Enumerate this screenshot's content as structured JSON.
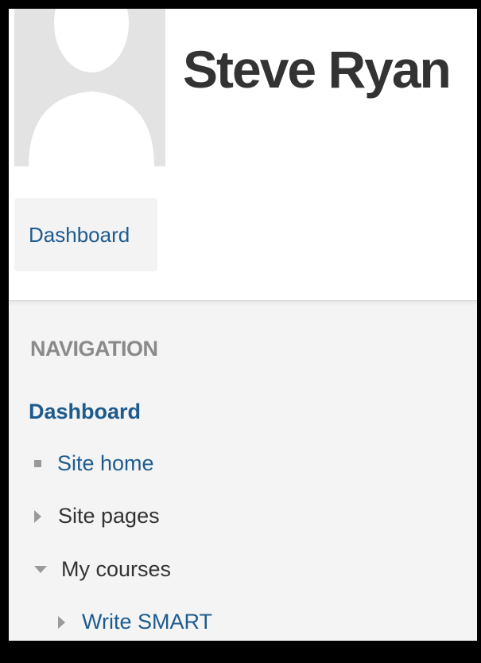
{
  "profile": {
    "name": "Steve Ryan",
    "avatar_icon": "default-user-avatar"
  },
  "header": {
    "dashboard_button_label": "Dashboard"
  },
  "navigation": {
    "heading": "NAVIGATION",
    "items": [
      {
        "label": "Dashboard",
        "icon": "",
        "link": true,
        "bold": true
      },
      {
        "label": "Site home",
        "icon": "bullet-icon",
        "link": true
      },
      {
        "label": "Site pages",
        "icon": "caret-right-icon",
        "link": false
      },
      {
        "label": "My courses",
        "icon": "caret-down-icon",
        "link": false
      },
      {
        "label": "Write SMART",
        "icon": "caret-right-icon",
        "link": true
      }
    ]
  },
  "colors": {
    "link": "#1d5b8e",
    "heading": "#8a8a8a",
    "text": "#333333",
    "panel_bg": "#f4f4f4"
  }
}
